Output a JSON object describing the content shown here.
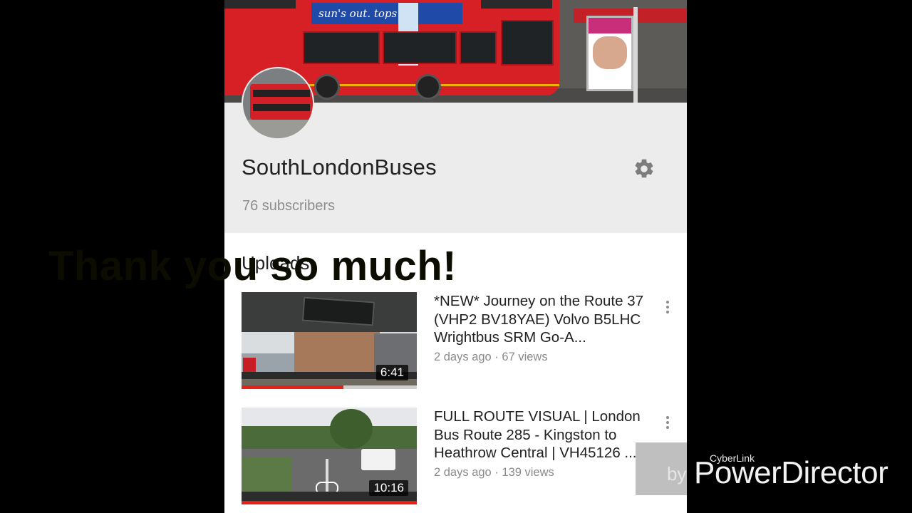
{
  "overlay": {
    "text": "Thank you so much!"
  },
  "banner": {
    "bus_ad_text": "sun's out. tops off."
  },
  "channel": {
    "name": "SouthLondonBuses",
    "subscribers": "76 subscribers"
  },
  "uploads": {
    "heading": "Uploads",
    "videos": [
      {
        "title": "*NEW* Journey on the Route 37 (VHP2 BV18YAE) Volvo B5LHC Wrightbus SRM Go-A...",
        "meta": "2 days ago · 67 views",
        "duration": "6:41",
        "watched_fraction": 0.58
      },
      {
        "title": "FULL ROUTE VISUAL | London Bus Route 285 - Kingston to Heathrow Central | VH45126 ...",
        "meta": "2 days ago · 139 views",
        "duration": "10:16",
        "watched_fraction": 1.0
      }
    ]
  },
  "watermark": {
    "by": "by",
    "brand_small": "CyberLink",
    "brand_large": "PowerDirector"
  },
  "icons": [
    "settings-gear-icon",
    "more-vert-icon"
  ],
  "colors": {
    "progress": "#e62117",
    "header_bg": "#ececec"
  }
}
